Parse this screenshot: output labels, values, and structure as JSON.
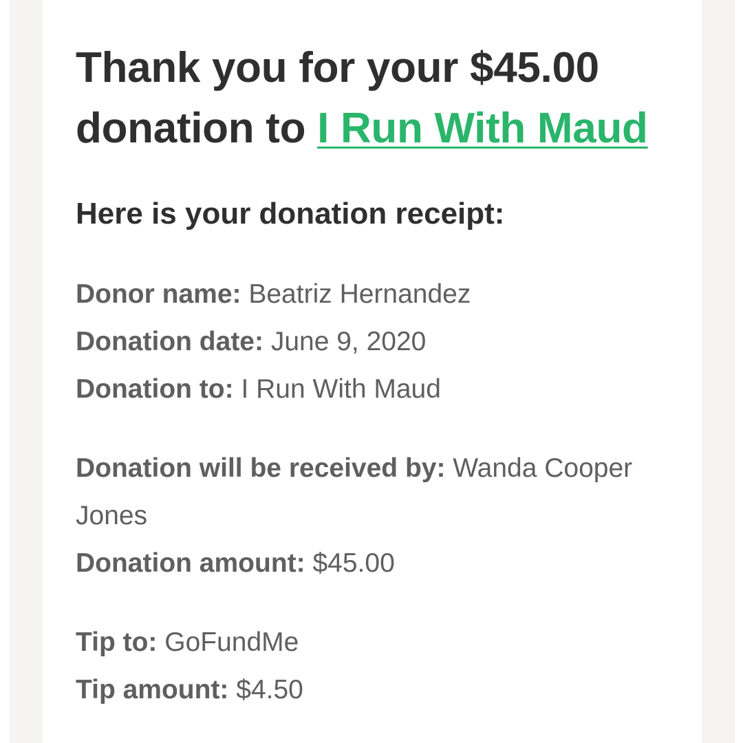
{
  "headline": {
    "prefix": "Thank you for your $45.00 donation to ",
    "link_text": "I Run With Maud"
  },
  "subheading": "Here is your donation receipt:",
  "colors": {
    "link": "#2ab56b",
    "heading_text": "#2f2f2f",
    "body_text": "#5f5f5f",
    "side_band": "#f5f4f1"
  },
  "receipt": {
    "donor_name": {
      "label": "Donor name:",
      "value": "Beatriz Hernandez"
    },
    "donation_date": {
      "label": "Donation date:",
      "value": "June 9, 2020"
    },
    "donation_to": {
      "label": "Donation to:",
      "value": "I Run With Maud"
    },
    "received_by": {
      "label": "Donation will be received by:",
      "value": "Wanda Cooper Jones"
    },
    "donation_amount": {
      "label": "Donation amount:",
      "value": "$45.00"
    },
    "tip_to": {
      "label": "Tip to:",
      "value": "GoFundMe"
    },
    "tip_amount": {
      "label": "Tip amount:",
      "value": "$4.50"
    }
  }
}
